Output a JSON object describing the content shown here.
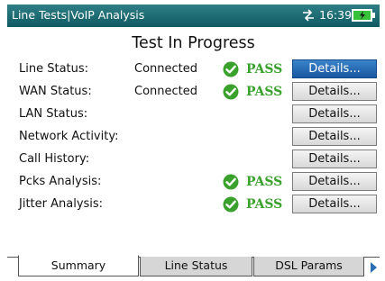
{
  "window": {
    "title": "Line Tests|VoIP Analysis",
    "time": "16:39"
  },
  "page": {
    "title": "Test In Progress"
  },
  "rows": [
    {
      "label": "Line Status:",
      "value": "Connected",
      "pass": "PASS",
      "details": "Details..."
    },
    {
      "label": "WAN Status:",
      "value": "Connected",
      "pass": "PASS",
      "details": "Details..."
    },
    {
      "label": "LAN Status:",
      "value": "",
      "pass": "",
      "details": "Details..."
    },
    {
      "label": "Network Activity:",
      "value": "",
      "pass": "",
      "details": "Details..."
    },
    {
      "label": "Call History:",
      "value": "",
      "pass": "",
      "details": "Details..."
    },
    {
      "label": "Pcks Analysis:",
      "value": "",
      "pass": "PASS",
      "details": "Details..."
    },
    {
      "label": "Jitter Analysis:",
      "value": "",
      "pass": "PASS",
      "details": "Details..."
    }
  ],
  "tabs": [
    {
      "label": "Summary",
      "active": true
    },
    {
      "label": "Line Status",
      "active": false
    },
    {
      "label": "DSL Params",
      "active": false
    }
  ],
  "icons": {
    "network": "network-arrows-icon",
    "battery": "battery-charging-icon",
    "check": "check-circle-icon",
    "scroll": "scroll-right-icon"
  },
  "colors": {
    "titlebar": "#1f6e76",
    "pass": "#3aa12d",
    "selected_button": "#2a6fb6"
  }
}
